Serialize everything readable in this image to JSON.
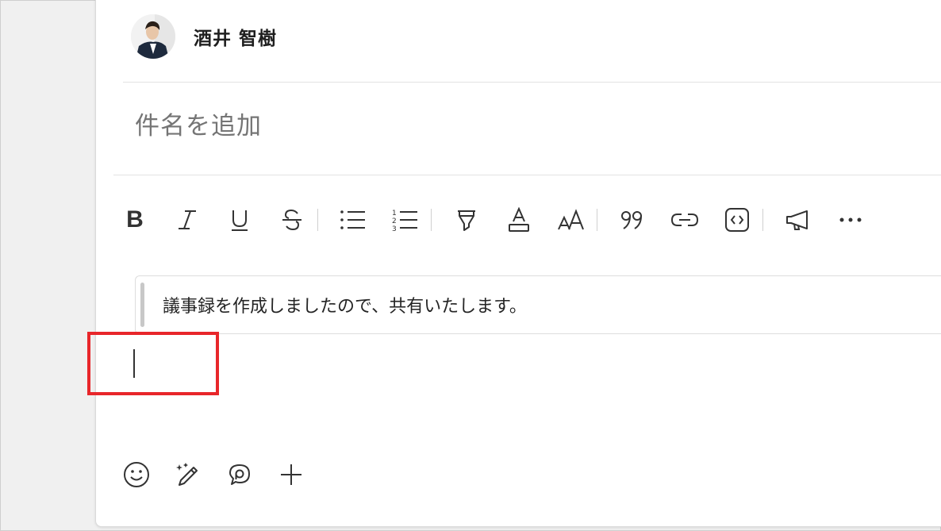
{
  "sender": {
    "name": "酒井 智樹"
  },
  "subject": {
    "placeholder": "件名を追加"
  },
  "toolbar": {
    "bold_label": "B",
    "icons": [
      "bold-icon",
      "italic-icon",
      "underline-icon",
      "strikethrough-icon",
      "bulleted-list-icon",
      "numbered-list-icon",
      "highlight-icon",
      "font-color-icon",
      "font-size-icon",
      "quote-icon",
      "link-icon",
      "code-block-icon",
      "announcement-icon",
      "more-options-icon"
    ]
  },
  "quote": {
    "text": "議事録を作成しましたので、共有いたします。"
  },
  "bottom_actions": {
    "icons": [
      "emoji-icon",
      "copilot-rewrite-icon",
      "loop-component-icon",
      "add-icon"
    ]
  },
  "colors": {
    "highlight_border": "#e8262a",
    "background": "#f0f0f0",
    "card": "#ffffff"
  }
}
